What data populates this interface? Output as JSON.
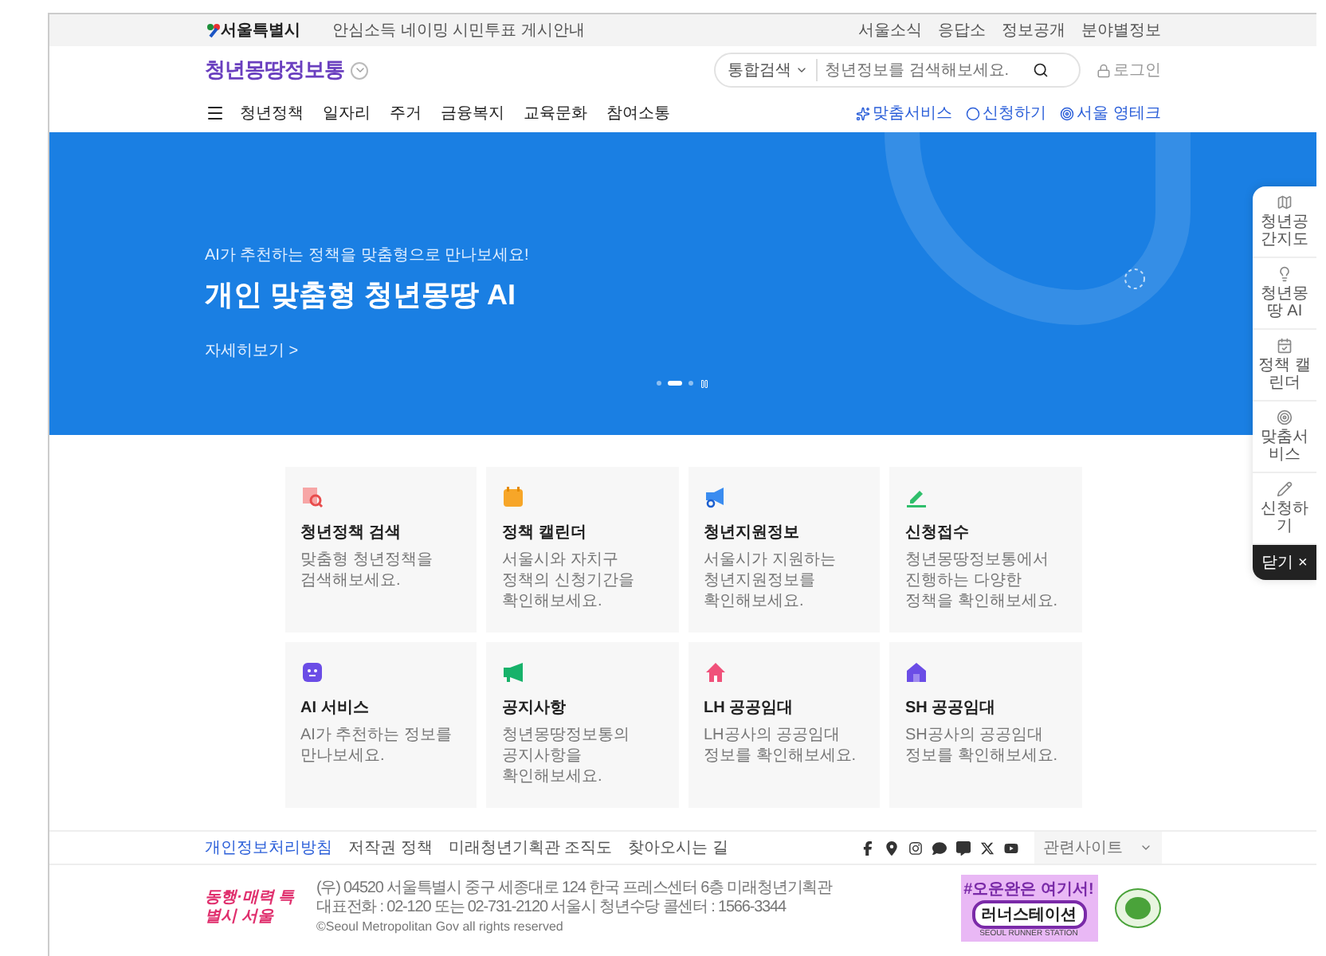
{
  "top_bar": {
    "logo": "서울특별시",
    "notice": "안심소득 네이밍 시민투표 게시안내",
    "links": [
      "서울소식",
      "응답소",
      "정보공개",
      "분야별정보"
    ]
  },
  "header": {
    "logo": "청년몽땅정보통",
    "search": {
      "scope": "통합검색",
      "placeholder": "청년정보를 검색해보세요."
    },
    "login": "로그인"
  },
  "nav": {
    "items": [
      "청년정책",
      "일자리",
      "주거",
      "금융복지",
      "교육문화",
      "참여소통"
    ],
    "quick_links": [
      "맞춤서비스",
      "신청하기",
      "서울 영테크"
    ]
  },
  "hero": {
    "subtitle": "AI가 추천하는 정책을 맞춤형으로 만나보세요!",
    "title": "개인 맞춤형 청년몽땅 AI",
    "more": "자세히보기 >",
    "slides": [
      {
        "selected": false
      },
      {
        "selected": true
      },
      {
        "selected": false
      }
    ]
  },
  "side_panel": {
    "items": [
      "청년공간지도",
      "청년몽땅 AI",
      "정책 캘린더",
      "맞춤서비스",
      "신청하기"
    ],
    "close": "닫기 ×"
  },
  "services": [
    {
      "title": "청년정책 검색",
      "description": "맞춤형 청년정책을 검색해보세요."
    },
    {
      "title": "정책 캘린더",
      "description": "서울시와 자치구 정책의 신청기간을 확인해보세요."
    },
    {
      "title": "청년지원정보",
      "description": "서울시가 지원하는 청년지원정보를 확인해보세요."
    },
    {
      "title": "신청접수",
      "description": "청년몽땅정보통에서 진행하는 다양한 정책을 확인해보세요."
    },
    {
      "title": "AI 서비스",
      "description": "AI가 추천하는 정보를 만나보세요."
    },
    {
      "title": "공지사항",
      "description": "청년몽땅정보통의 공지사항을 확인해보세요."
    },
    {
      "title": "LH 공공임대",
      "description": "LH공사의 공공임대 정보를 확인해보세요."
    },
    {
      "title": "SH 공공임대",
      "description": "SH공사의 공공임대 정보를 확인해보세요."
    }
  ],
  "footer": {
    "links": [
      {
        "label": "개인정보처리방침",
        "highlighted": true
      },
      {
        "label": "저작권 정책",
        "highlighted": false
      },
      {
        "label": "미래청년기획관 조직도",
        "highlighted": false
      },
      {
        "label": "찾아오시는 길",
        "highlighted": false
      }
    ],
    "related_sites": "관련사이트",
    "logo": "동행·매력 특별시 서울",
    "address": "(우) 04520 서울특별시 중구 세종대로 124 한국 프레스센터 6층 미래청년기획관",
    "phone": "대표전화 : 02-120 또는 02-731-2120   서울시 청년수당 콜센터 : 1566-3344",
    "copyright": "©Seoul Metropolitan Gov all rights reserved",
    "ad": {
      "tag": "#오운완은 여기서!",
      "title": "러너스테이션",
      "caption": "SEOUL RUNNER STATION"
    }
  }
}
